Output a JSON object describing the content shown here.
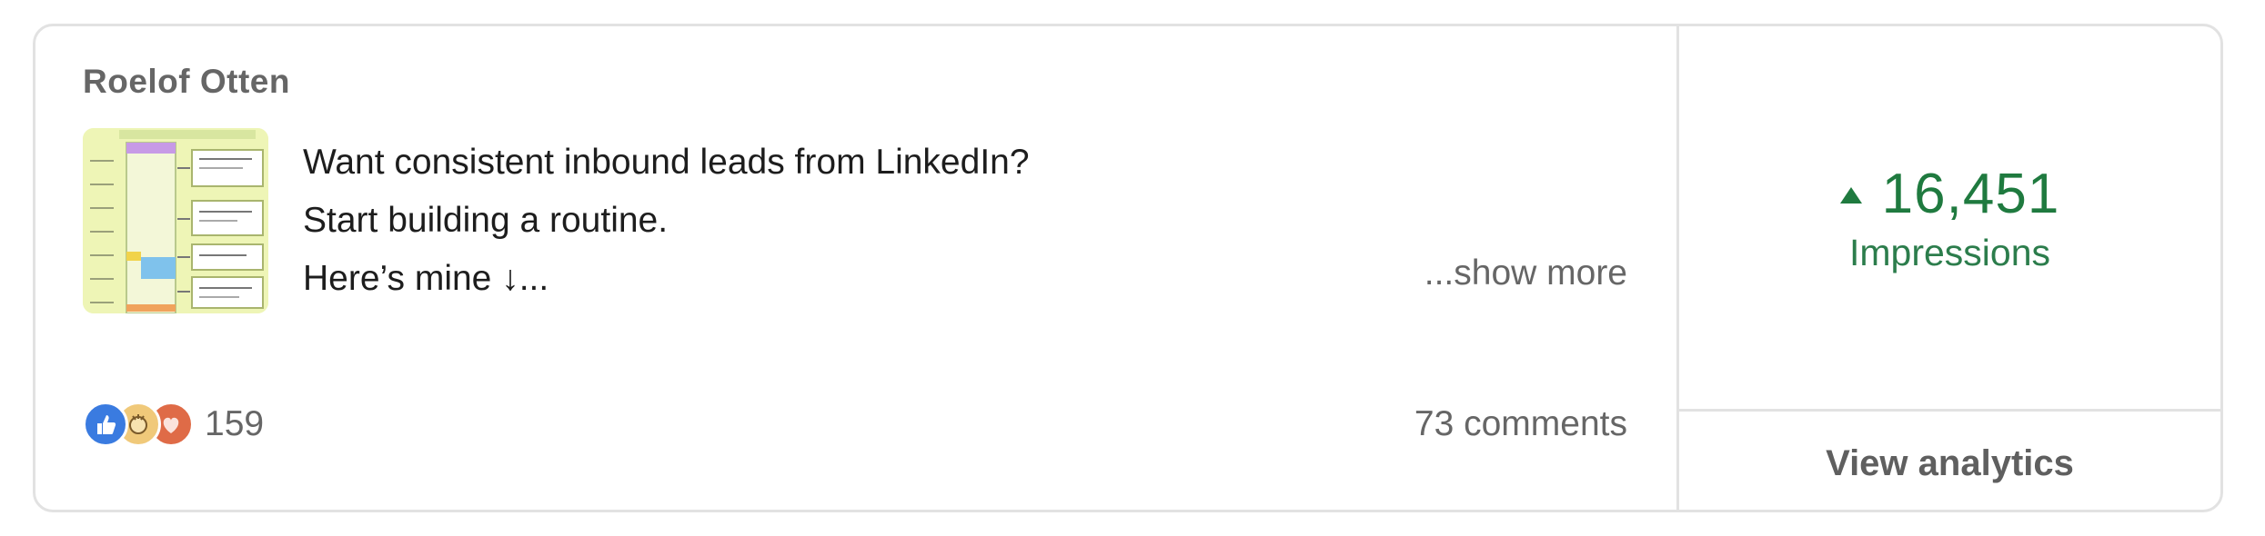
{
  "post": {
    "author": "Roelof Otten",
    "text_lines": [
      "Want consistent inbound leads from LinkedIn?",
      "Start building a routine.",
      "Here’s mine ↓..."
    ],
    "show_more_label": "...show more",
    "thumbnail_icon": "routine-calendar-image"
  },
  "reactions": {
    "icons": [
      "like-icon",
      "celebrate-icon",
      "love-icon"
    ],
    "count": "159"
  },
  "comments_label": "73 comments",
  "stats": {
    "trend_icon": "up-arrow-icon",
    "impressions_value": "16,451",
    "impressions_label": "Impressions",
    "accent_color": "#1f7a3f"
  },
  "actions": {
    "view_analytics_label": "View analytics"
  }
}
